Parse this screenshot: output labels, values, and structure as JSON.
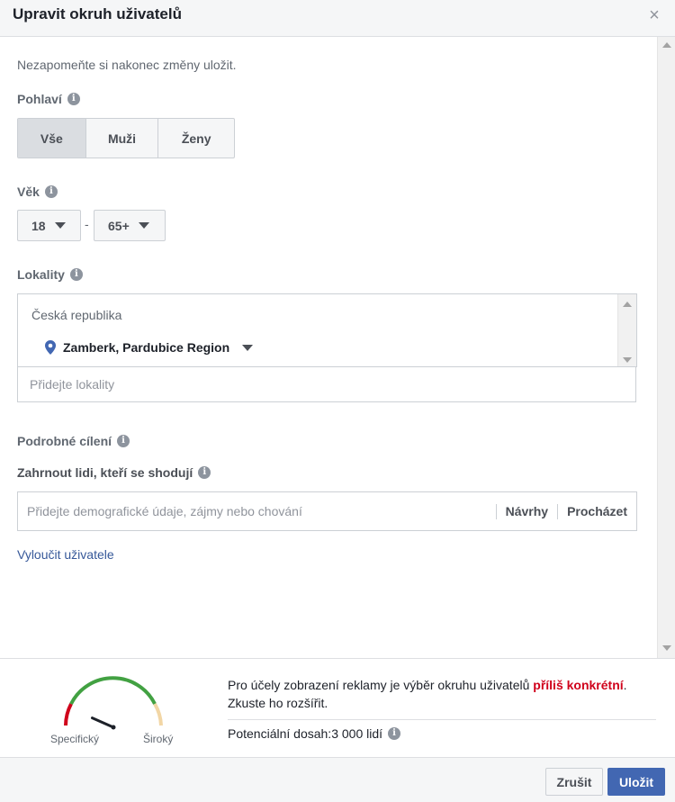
{
  "header": {
    "title": "Upravit okruh uživatelů",
    "close_icon": "close-icon"
  },
  "reminder": "Nezapomeňte si nakonec změny uložit.",
  "gender": {
    "label": "Pohlaví",
    "options": [
      {
        "label": "Vše",
        "active": true
      },
      {
        "label": "Muži",
        "active": false
      },
      {
        "label": "Ženy",
        "active": false
      }
    ]
  },
  "age": {
    "label": "Věk",
    "from": "18",
    "to": "65+",
    "separator": "-"
  },
  "locations": {
    "label": "Lokality",
    "country": "Česká republika",
    "item": "Zamberk, Pardubice Region",
    "input_placeholder": "Přidejte lokality"
  },
  "detailed": {
    "label": "Podrobné cílení",
    "include_label": "Zahrnout lidi, kteří se shodují",
    "input_placeholder": "Přidejte demografické údaje, zájmy nebo chování",
    "suggestions": "Návrhy",
    "browse": "Procházet",
    "exclude_link": "Vyloučit uživatele"
  },
  "reach": {
    "gauge_left": "Specifický",
    "gauge_right": "Široký",
    "gauge_level": 0.3,
    "message_pre": "Pro účely zobrazení reklamy je výběr okruhu uživatelů ",
    "message_warn": "příliš konkrétní",
    "message_post": ". Zkuste ho rozšířit.",
    "potential": "Potenciální dosah:3 000 lidí"
  },
  "buttons": {
    "cancel": "Zrušit",
    "save": "Uložit"
  },
  "colors": {
    "accent": "#4267b2",
    "warning": "#d0021b",
    "link": "#365899"
  }
}
